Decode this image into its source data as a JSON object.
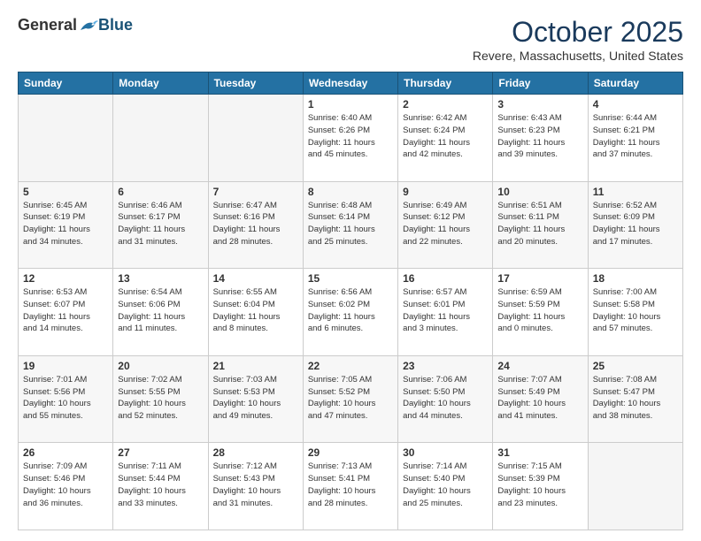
{
  "header": {
    "logo_general": "General",
    "logo_blue": "Blue",
    "month": "October 2025",
    "location": "Revere, Massachusetts, United States"
  },
  "days_of_week": [
    "Sunday",
    "Monday",
    "Tuesday",
    "Wednesday",
    "Thursday",
    "Friday",
    "Saturday"
  ],
  "weeks": [
    [
      {
        "day": "",
        "info": ""
      },
      {
        "day": "",
        "info": ""
      },
      {
        "day": "",
        "info": ""
      },
      {
        "day": "1",
        "info": "Sunrise: 6:40 AM\nSunset: 6:26 PM\nDaylight: 11 hours\nand 45 minutes."
      },
      {
        "day": "2",
        "info": "Sunrise: 6:42 AM\nSunset: 6:24 PM\nDaylight: 11 hours\nand 42 minutes."
      },
      {
        "day": "3",
        "info": "Sunrise: 6:43 AM\nSunset: 6:23 PM\nDaylight: 11 hours\nand 39 minutes."
      },
      {
        "day": "4",
        "info": "Sunrise: 6:44 AM\nSunset: 6:21 PM\nDaylight: 11 hours\nand 37 minutes."
      }
    ],
    [
      {
        "day": "5",
        "info": "Sunrise: 6:45 AM\nSunset: 6:19 PM\nDaylight: 11 hours\nand 34 minutes."
      },
      {
        "day": "6",
        "info": "Sunrise: 6:46 AM\nSunset: 6:17 PM\nDaylight: 11 hours\nand 31 minutes."
      },
      {
        "day": "7",
        "info": "Sunrise: 6:47 AM\nSunset: 6:16 PM\nDaylight: 11 hours\nand 28 minutes."
      },
      {
        "day": "8",
        "info": "Sunrise: 6:48 AM\nSunset: 6:14 PM\nDaylight: 11 hours\nand 25 minutes."
      },
      {
        "day": "9",
        "info": "Sunrise: 6:49 AM\nSunset: 6:12 PM\nDaylight: 11 hours\nand 22 minutes."
      },
      {
        "day": "10",
        "info": "Sunrise: 6:51 AM\nSunset: 6:11 PM\nDaylight: 11 hours\nand 20 minutes."
      },
      {
        "day": "11",
        "info": "Sunrise: 6:52 AM\nSunset: 6:09 PM\nDaylight: 11 hours\nand 17 minutes."
      }
    ],
    [
      {
        "day": "12",
        "info": "Sunrise: 6:53 AM\nSunset: 6:07 PM\nDaylight: 11 hours\nand 14 minutes."
      },
      {
        "day": "13",
        "info": "Sunrise: 6:54 AM\nSunset: 6:06 PM\nDaylight: 11 hours\nand 11 minutes."
      },
      {
        "day": "14",
        "info": "Sunrise: 6:55 AM\nSunset: 6:04 PM\nDaylight: 11 hours\nand 8 minutes."
      },
      {
        "day": "15",
        "info": "Sunrise: 6:56 AM\nSunset: 6:02 PM\nDaylight: 11 hours\nand 6 minutes."
      },
      {
        "day": "16",
        "info": "Sunrise: 6:57 AM\nSunset: 6:01 PM\nDaylight: 11 hours\nand 3 minutes."
      },
      {
        "day": "17",
        "info": "Sunrise: 6:59 AM\nSunset: 5:59 PM\nDaylight: 11 hours\nand 0 minutes."
      },
      {
        "day": "18",
        "info": "Sunrise: 7:00 AM\nSunset: 5:58 PM\nDaylight: 10 hours\nand 57 minutes."
      }
    ],
    [
      {
        "day": "19",
        "info": "Sunrise: 7:01 AM\nSunset: 5:56 PM\nDaylight: 10 hours\nand 55 minutes."
      },
      {
        "day": "20",
        "info": "Sunrise: 7:02 AM\nSunset: 5:55 PM\nDaylight: 10 hours\nand 52 minutes."
      },
      {
        "day": "21",
        "info": "Sunrise: 7:03 AM\nSunset: 5:53 PM\nDaylight: 10 hours\nand 49 minutes."
      },
      {
        "day": "22",
        "info": "Sunrise: 7:05 AM\nSunset: 5:52 PM\nDaylight: 10 hours\nand 47 minutes."
      },
      {
        "day": "23",
        "info": "Sunrise: 7:06 AM\nSunset: 5:50 PM\nDaylight: 10 hours\nand 44 minutes."
      },
      {
        "day": "24",
        "info": "Sunrise: 7:07 AM\nSunset: 5:49 PM\nDaylight: 10 hours\nand 41 minutes."
      },
      {
        "day": "25",
        "info": "Sunrise: 7:08 AM\nSunset: 5:47 PM\nDaylight: 10 hours\nand 38 minutes."
      }
    ],
    [
      {
        "day": "26",
        "info": "Sunrise: 7:09 AM\nSunset: 5:46 PM\nDaylight: 10 hours\nand 36 minutes."
      },
      {
        "day": "27",
        "info": "Sunrise: 7:11 AM\nSunset: 5:44 PM\nDaylight: 10 hours\nand 33 minutes."
      },
      {
        "day": "28",
        "info": "Sunrise: 7:12 AM\nSunset: 5:43 PM\nDaylight: 10 hours\nand 31 minutes."
      },
      {
        "day": "29",
        "info": "Sunrise: 7:13 AM\nSunset: 5:41 PM\nDaylight: 10 hours\nand 28 minutes."
      },
      {
        "day": "30",
        "info": "Sunrise: 7:14 AM\nSunset: 5:40 PM\nDaylight: 10 hours\nand 25 minutes."
      },
      {
        "day": "31",
        "info": "Sunrise: 7:15 AM\nSunset: 5:39 PM\nDaylight: 10 hours\nand 23 minutes."
      },
      {
        "day": "",
        "info": ""
      }
    ]
  ]
}
